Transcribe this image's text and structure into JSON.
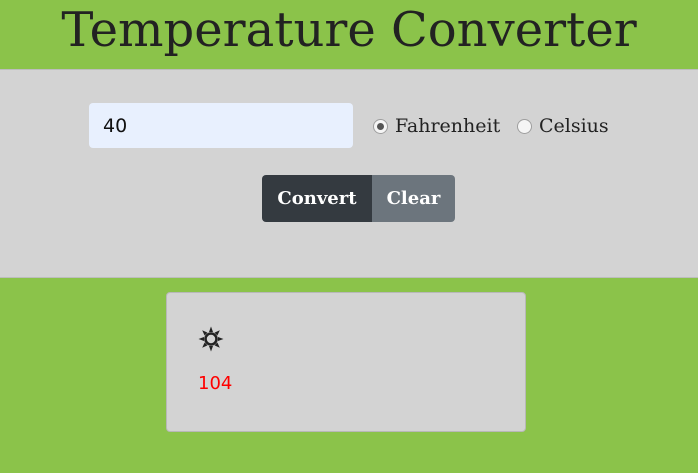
{
  "header": {
    "title": "Temperature Converter"
  },
  "form": {
    "input_value": "40",
    "units": [
      {
        "label": "Fahrenheit",
        "selected": true
      },
      {
        "label": "Celsius",
        "selected": false
      }
    ],
    "convert_label": "Convert",
    "clear_label": "Clear"
  },
  "result": {
    "icon": "sun-icon",
    "value": "104",
    "value_color": "#ff0000"
  },
  "colors": {
    "background": "#8bc34a",
    "panel": "#d3d3d3",
    "convert_button": "#343a40",
    "clear_button": "#6c757d",
    "input_background": "#e8f0fe"
  }
}
